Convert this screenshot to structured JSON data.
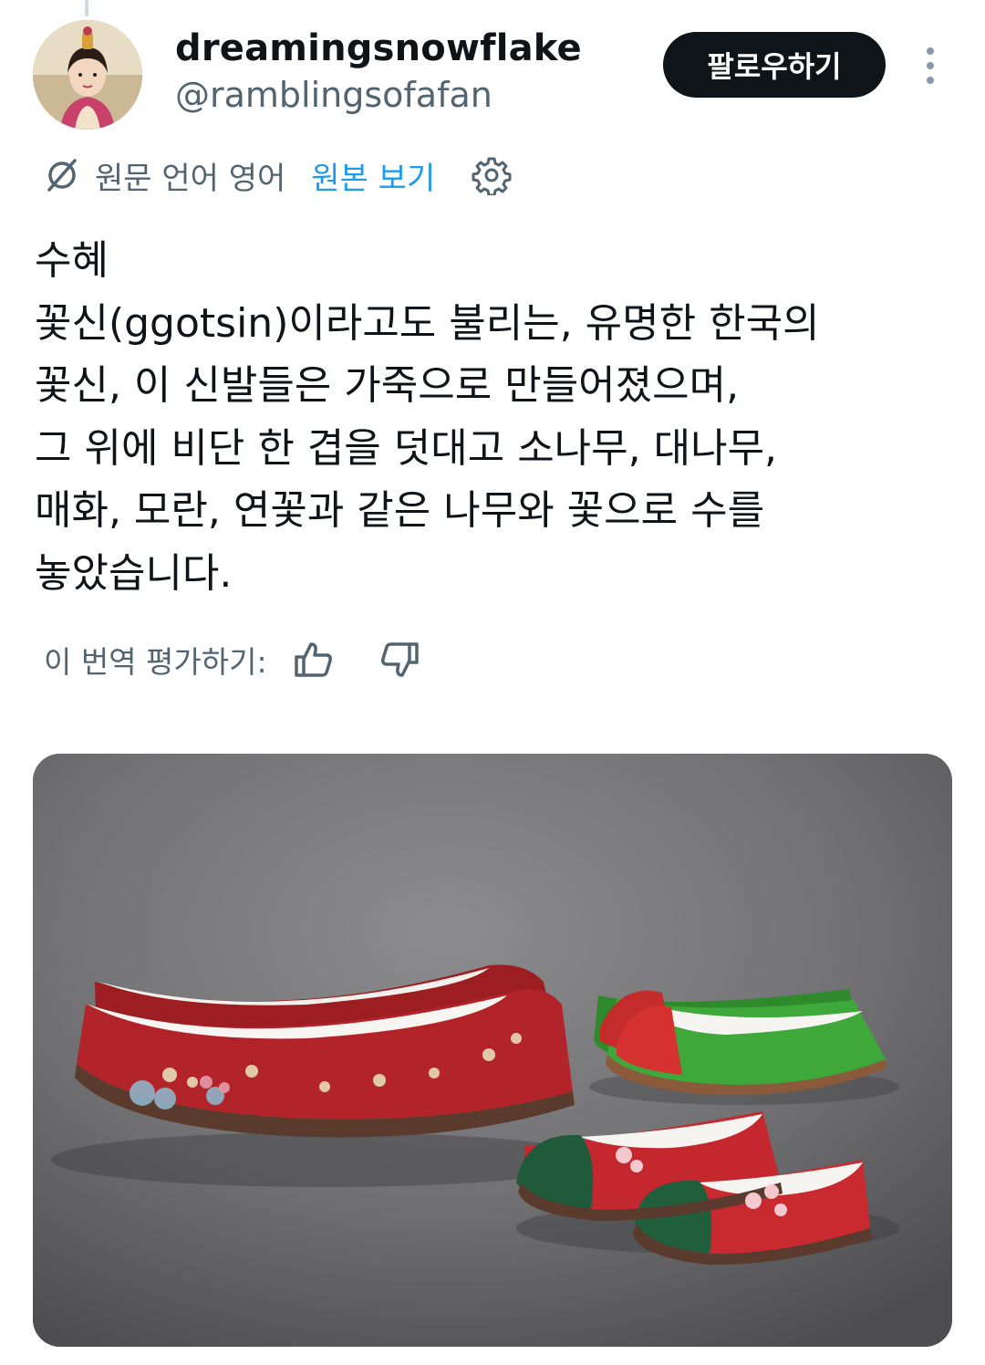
{
  "author": {
    "display_name": "dreamingsnowflake",
    "handle": "@ramblingsofafan",
    "avatar_icon": "avatar-portrait"
  },
  "actions": {
    "follow_label": "팔로우하기",
    "more_icon": "more-vertical-icon"
  },
  "translation": {
    "icon": "translate-icon",
    "original_language": "원문 언어 영어",
    "show_original": "원본 보기",
    "settings_icon": "gear-icon"
  },
  "post": {
    "lines": [
      "수혜",
      "꽃신(ggotsin)이라고도 불리는, 유명한 한국의",
      "꽃신, 이 신발들은 가죽으로 만들어졌으며,",
      "그 위에 비단 한 겹을 덧대고 소나무, 대나무,",
      "매화, 모란, 연꽃과 같은 나무와 꽃으로 수를",
      "놓았습니다."
    ]
  },
  "rating": {
    "label": "이 번역 평가하기:",
    "thumbs_up_icon": "thumbs-up-icon",
    "thumbs_down_icon": "thumbs-down-icon"
  },
  "media": {
    "image": "embroidered-silk-shoes-photo"
  },
  "colors": {
    "text_primary": "#0f1419",
    "text_secondary": "#536471",
    "link": "#1d9bf0",
    "follow_bg": "#0f1419"
  }
}
